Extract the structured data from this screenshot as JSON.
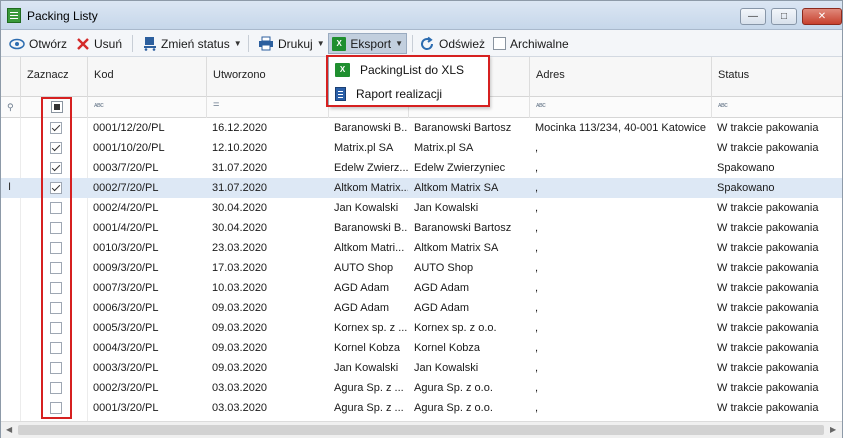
{
  "window": {
    "title": "Packing Listy"
  },
  "toolbar": {
    "open": "Otwórz",
    "delete": "Usuń",
    "change_status": "Zmień status",
    "print": "Drukuj",
    "export": "Eksport",
    "refresh": "Odśwież",
    "archive": "Archiwalne"
  },
  "export_menu": {
    "items": [
      "PackingList do XLS",
      "Raport realizacji"
    ]
  },
  "columns": {
    "select": "Zaznacz",
    "code": "Kod",
    "created": "Utworzono",
    "address": "Adres",
    "status": "Status"
  },
  "filter_tokens": {
    "text": "ᴀʙc",
    "date": "="
  },
  "rows": [
    {
      "checked": true,
      "code": "0001/12/20/PL",
      "created": "16.12.2020",
      "short": "Baranowski B...",
      "name": "Baranowski Bartosz",
      "address": "Mocinka 113/234, 40-001 Katowice",
      "status": "W trakcie pakowania"
    },
    {
      "checked": true,
      "code": "0001/10/20/PL",
      "created": "12.10.2020",
      "short": "Matrix.pl SA",
      "name": "Matrix.pl SA",
      "address": ",",
      "status": "W trakcie pakowania"
    },
    {
      "checked": true,
      "code": "0003/7/20/PL",
      "created": "31.07.2020",
      "short": "Edelw Zwierz...",
      "name": "Edelw Zwierzyniec",
      "address": ",",
      "status": "Spakowano"
    },
    {
      "checked": true,
      "code": "0002/7/20/PL",
      "created": "31.07.2020",
      "short": "Altkom Matrix...",
      "name": "Altkom Matrix SA",
      "address": ",",
      "status": "Spakowano"
    },
    {
      "checked": false,
      "code": "0002/4/20/PL",
      "created": "30.04.2020",
      "short": "Jan Kowalski",
      "name": "Jan Kowalski",
      "address": ",",
      "status": "W trakcie pakowania"
    },
    {
      "checked": false,
      "code": "0001/4/20/PL",
      "created": "30.04.2020",
      "short": "Baranowski B...",
      "name": "Baranowski Bartosz",
      "address": ",",
      "status": "W trakcie pakowania"
    },
    {
      "checked": false,
      "code": "0010/3/20/PL",
      "created": "23.03.2020",
      "short": "Altkom Matri...",
      "name": "Altkom Matrix SA",
      "address": ",",
      "status": "W trakcie pakowania"
    },
    {
      "checked": false,
      "code": "0009/3/20/PL",
      "created": "17.03.2020",
      "short": "AUTO Shop",
      "name": "AUTO Shop",
      "address": ",",
      "status": "W trakcie pakowania"
    },
    {
      "checked": false,
      "code": "0007/3/20/PL",
      "created": "10.03.2020",
      "short": "AGD Adam",
      "name": "AGD Adam",
      "address": ",",
      "status": "W trakcie pakowania"
    },
    {
      "checked": false,
      "code": "0006/3/20/PL",
      "created": "09.03.2020",
      "short": "AGD Adam",
      "name": "AGD Adam",
      "address": ",",
      "status": "W trakcie pakowania"
    },
    {
      "checked": false,
      "code": "0005/3/20/PL",
      "created": "09.03.2020",
      "short": "Kornex sp. z ...",
      "name": "Kornex sp. z o.o.",
      "address": ",",
      "status": "W trakcie pakowania"
    },
    {
      "checked": false,
      "code": "0004/3/20/PL",
      "created": "09.03.2020",
      "short": "Kornel Kobza",
      "name": "Kornel Kobza",
      "address": ",",
      "status": "W trakcie pakowania"
    },
    {
      "checked": false,
      "code": "0003/3/20/PL",
      "created": "09.03.2020",
      "short": "Jan Kowalski",
      "name": "Jan Kowalski",
      "address": ",",
      "status": "W trakcie pakowania"
    },
    {
      "checked": false,
      "code": "0002/3/20/PL",
      "created": "03.03.2020",
      "short": "Agura Sp. z ...",
      "name": "Agura Sp. z o.o.",
      "address": ",",
      "status": "W trakcie pakowania"
    },
    {
      "checked": false,
      "code": "0001/3/20/PL",
      "created": "03.03.2020",
      "short": "Agura Sp. z ...",
      "name": "Agura Sp. z o.o.",
      "address": ",",
      "status": "W trakcie pakowania"
    }
  ],
  "selected_row_index": 3,
  "colors": {
    "highlight_frame": "#d62020",
    "selection": "#dde8f5",
    "excel_green": "#1f8f2f"
  }
}
